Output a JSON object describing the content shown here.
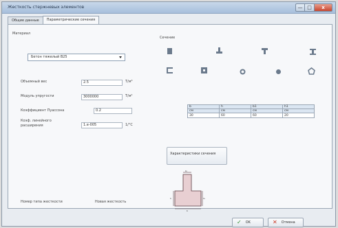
{
  "window": {
    "title": "Жесткость стержневых элементов",
    "controls": {
      "minimize": "—",
      "maximize": "□",
      "close": "x"
    }
  },
  "tabs": [
    {
      "label": "Общие данные",
      "active": false
    },
    {
      "label": "Параметрические сечения",
      "active": true
    }
  ],
  "material": {
    "group_label": "Материал",
    "selected": "Бетон тяжелый B25"
  },
  "properties": {
    "weight": {
      "label": "Объемный вес",
      "value": "2.5",
      "unit": "T/м³"
    },
    "modulus": {
      "label": "Модуль упругости",
      "value": "3000000",
      "unit": "T/м²"
    },
    "poisson": {
      "label": "Коэффициент Пуассона",
      "value": "0.2"
    },
    "expansion": {
      "label_line1": "Коэф. линейного",
      "label_line2": "расширения",
      "value": "1.e-005",
      "unit": "1/°C"
    }
  },
  "section": {
    "group_label": "Сечение",
    "icons": [
      {
        "name": "solid-rectangle-icon"
      },
      {
        "name": "tee-section-icon"
      },
      {
        "name": "inverted-tee-section-icon"
      },
      {
        "name": "i-beam-section-icon"
      },
      {
        "name": "channel-section-icon"
      },
      {
        "name": "box-section-icon"
      },
      {
        "name": "ring-section-icon"
      },
      {
        "name": "solid-circle-icon"
      },
      {
        "name": "polygon-section-icon"
      }
    ],
    "table": {
      "headers": [
        "b",
        "h",
        "b1",
        "h1"
      ],
      "units": [
        "см",
        "см",
        "см",
        "см"
      ],
      "values": [
        "30",
        "60",
        "60",
        "20"
      ]
    },
    "characteristics_button": "Характеристики сечения",
    "colors": {
      "section_fill": "#e8cfd2",
      "section_stroke": "#5a3a40"
    }
  },
  "stiffness": {
    "number_label": "Номер типа жесткости",
    "new_label": "Новая жесткость"
  },
  "footer": {
    "ok_label": "OK",
    "cancel_label": "Отмена"
  }
}
